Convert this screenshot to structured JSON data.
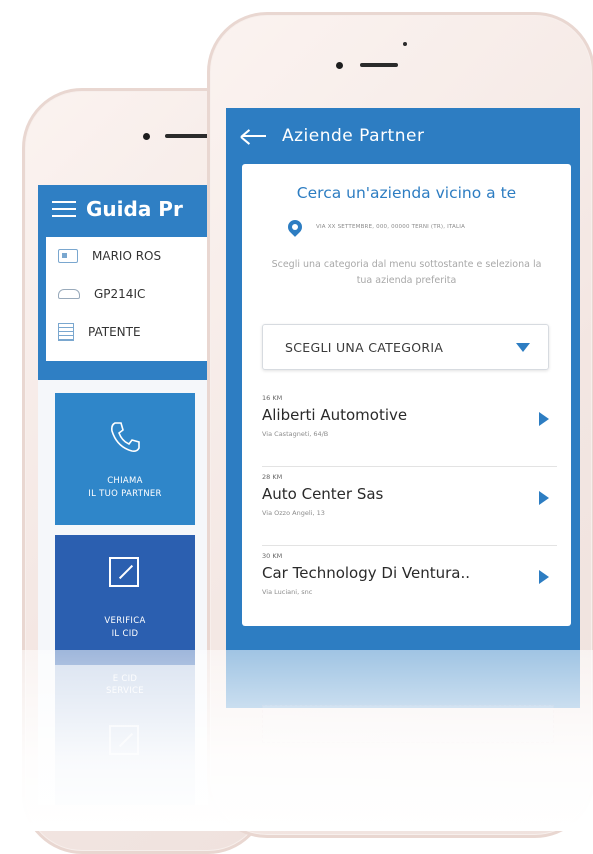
{
  "back_screen": {
    "title": "Guida Pr",
    "info_rows": [
      {
        "label": "MARIO ROS",
        "icon": "id-card-icon"
      },
      {
        "label": "GP214IC",
        "icon": "car-icon"
      },
      {
        "label": "PATENTE",
        "icon": "document-icon"
      }
    ],
    "tiles": [
      {
        "line1": "CHIAMA",
        "line2": "IL TUO PARTNER",
        "icon": "phone-icon"
      },
      {
        "line1": "VERIFICA",
        "line2": "IL CID",
        "icon": "edit-icon"
      },
      {
        "line1": "E CID",
        "line2": "SERVICE",
        "icon": "document-icon"
      }
    ]
  },
  "front_screen": {
    "title": "Aziende Partner",
    "card_title": "Cerca un'azienda vicino a te",
    "location_text": "VIA XX SETTEMBRE, 000, 00000 TERNI (TR), ITALIA",
    "help_text": "Scegli una categoria dal menu sottostante e seleziona la tua azienda preferita",
    "select_label": "SCEGLI UNA CATEGORIA",
    "items": [
      {
        "distance": "16 KM",
        "name": "Aliberti Automotive",
        "address": "Via Castagneti, 64/B"
      },
      {
        "distance": "28 KM",
        "name": "Auto Center Sas",
        "address": "Via Ozzo Angeli, 13"
      },
      {
        "distance": "30 KM",
        "name": "Car Technology Di Ventura..",
        "address": "Via Luciani, snc"
      }
    ]
  },
  "colors": {
    "primary": "#2d7dc2",
    "tile_blue": "#2f86c9",
    "tile_dark": "#2b5fb0",
    "phone_frame": "#f3e6e2"
  }
}
